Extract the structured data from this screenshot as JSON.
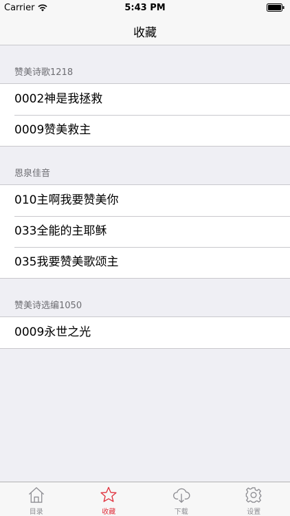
{
  "status": {
    "carrier": "Carrier",
    "time": "5:43 PM"
  },
  "nav": {
    "title": "收藏"
  },
  "sections": [
    {
      "header": "赞美诗歌1218",
      "items": [
        "0002神是我拯救",
        "0009赞美救主"
      ]
    },
    {
      "header": "恩泉佳音",
      "items": [
        "010主啊我要赞美你",
        "033全能的主耶稣",
        "035我要赞美歌颂主"
      ]
    },
    {
      "header": "赞美诗选编1050",
      "items": [
        "0009永世之光"
      ]
    }
  ],
  "tabs": [
    {
      "label": "目录",
      "icon": "home-icon"
    },
    {
      "label": "收藏",
      "icon": "star-icon"
    },
    {
      "label": "下载",
      "icon": "cloud-download-icon"
    },
    {
      "label": "设置",
      "icon": "gear-icon"
    }
  ],
  "colors": {
    "active": "#e0313d",
    "inactive": "#8e8e93",
    "background": "#efeff4"
  }
}
